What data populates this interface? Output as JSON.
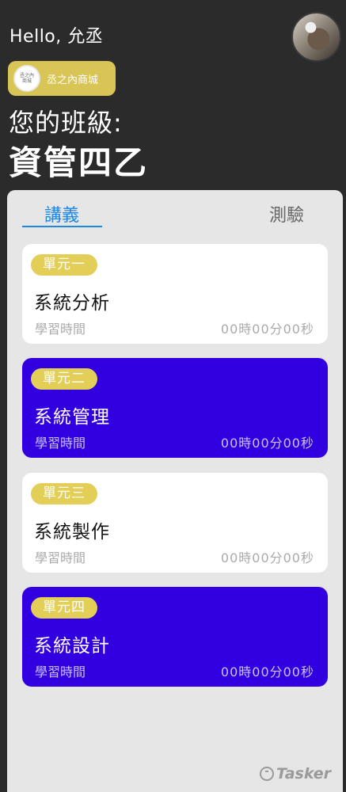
{
  "header": {
    "greeting": "Hello, 允丞",
    "shop": {
      "logo_text": "丞之內商城",
      "label": "丞之內商城"
    },
    "class_label": "您的班級:",
    "class_name": "資管四乙"
  },
  "tabs": [
    {
      "label": "講義",
      "active": true
    },
    {
      "label": "測驗",
      "active": false
    }
  ],
  "cards": [
    {
      "unit": "單元一",
      "title": "系統分析",
      "study_label": "學習時間",
      "study_time": "00時00分00秒",
      "theme": "light"
    },
    {
      "unit": "單元二",
      "title": "系統管理",
      "study_label": "學習時間",
      "study_time": "00時00分00秒",
      "theme": "dark"
    },
    {
      "unit": "單元三",
      "title": "系統製作",
      "study_label": "學習時間",
      "study_time": "00時00分00秒",
      "theme": "light"
    },
    {
      "unit": "單元四",
      "title": "系統設計",
      "study_label": "學習時間",
      "study_time": "00時00分00秒",
      "theme": "dark"
    }
  ],
  "colors": {
    "background": "#2b2b2b",
    "accent_blue": "#1e88e5",
    "card_dark": "#3200e0",
    "badge_gold": "#e3cf58"
  },
  "watermark": "Tasker"
}
